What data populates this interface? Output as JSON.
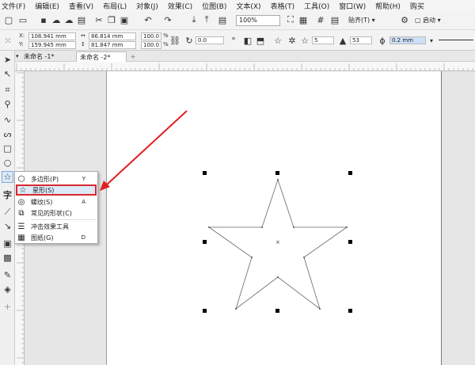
{
  "menu": [
    "文件(F)",
    "编辑(E)",
    "查看(V)",
    "布局(L)",
    "对象(J)",
    "效果(C)",
    "位图(B)",
    "文本(X)",
    "表格(T)",
    "工具(O)",
    "窗口(W)",
    "帮助(H)",
    "购买"
  ],
  "toolbar": {
    "zoom": "100%",
    "snap_label": "贴齐(T)",
    "launch_label": "启动"
  },
  "propbar": {
    "x_label": "X:",
    "x_value": "108.941 mm",
    "y_label": "Y:",
    "y_value": "159.945 mm",
    "w_value": "86.814 mm",
    "h_value": "81.847 mm",
    "sx_value": "100.0",
    "sy_value": "100.0",
    "pct": "%",
    "rotation": "0.0",
    "points": "5",
    "sharpness": "53",
    "outline": "0.2 mm"
  },
  "tabs": [
    "未命名 -1*",
    "未命名 -2*"
  ],
  "flyout": {
    "items": [
      {
        "label": "多边形(P)",
        "shortcut": "Y"
      },
      {
        "label": "星形(S)",
        "shortcut": ""
      },
      {
        "label": "螺纹(S)",
        "shortcut": "A"
      },
      {
        "label": "常见的形状(C)",
        "shortcut": ""
      },
      {
        "label": "冲击效果工具",
        "shortcut": ""
      },
      {
        "label": "图纸(G)",
        "shortcut": "D"
      }
    ]
  },
  "colors": {
    "highlight": "#d9272e",
    "page": "#ffffff"
  }
}
